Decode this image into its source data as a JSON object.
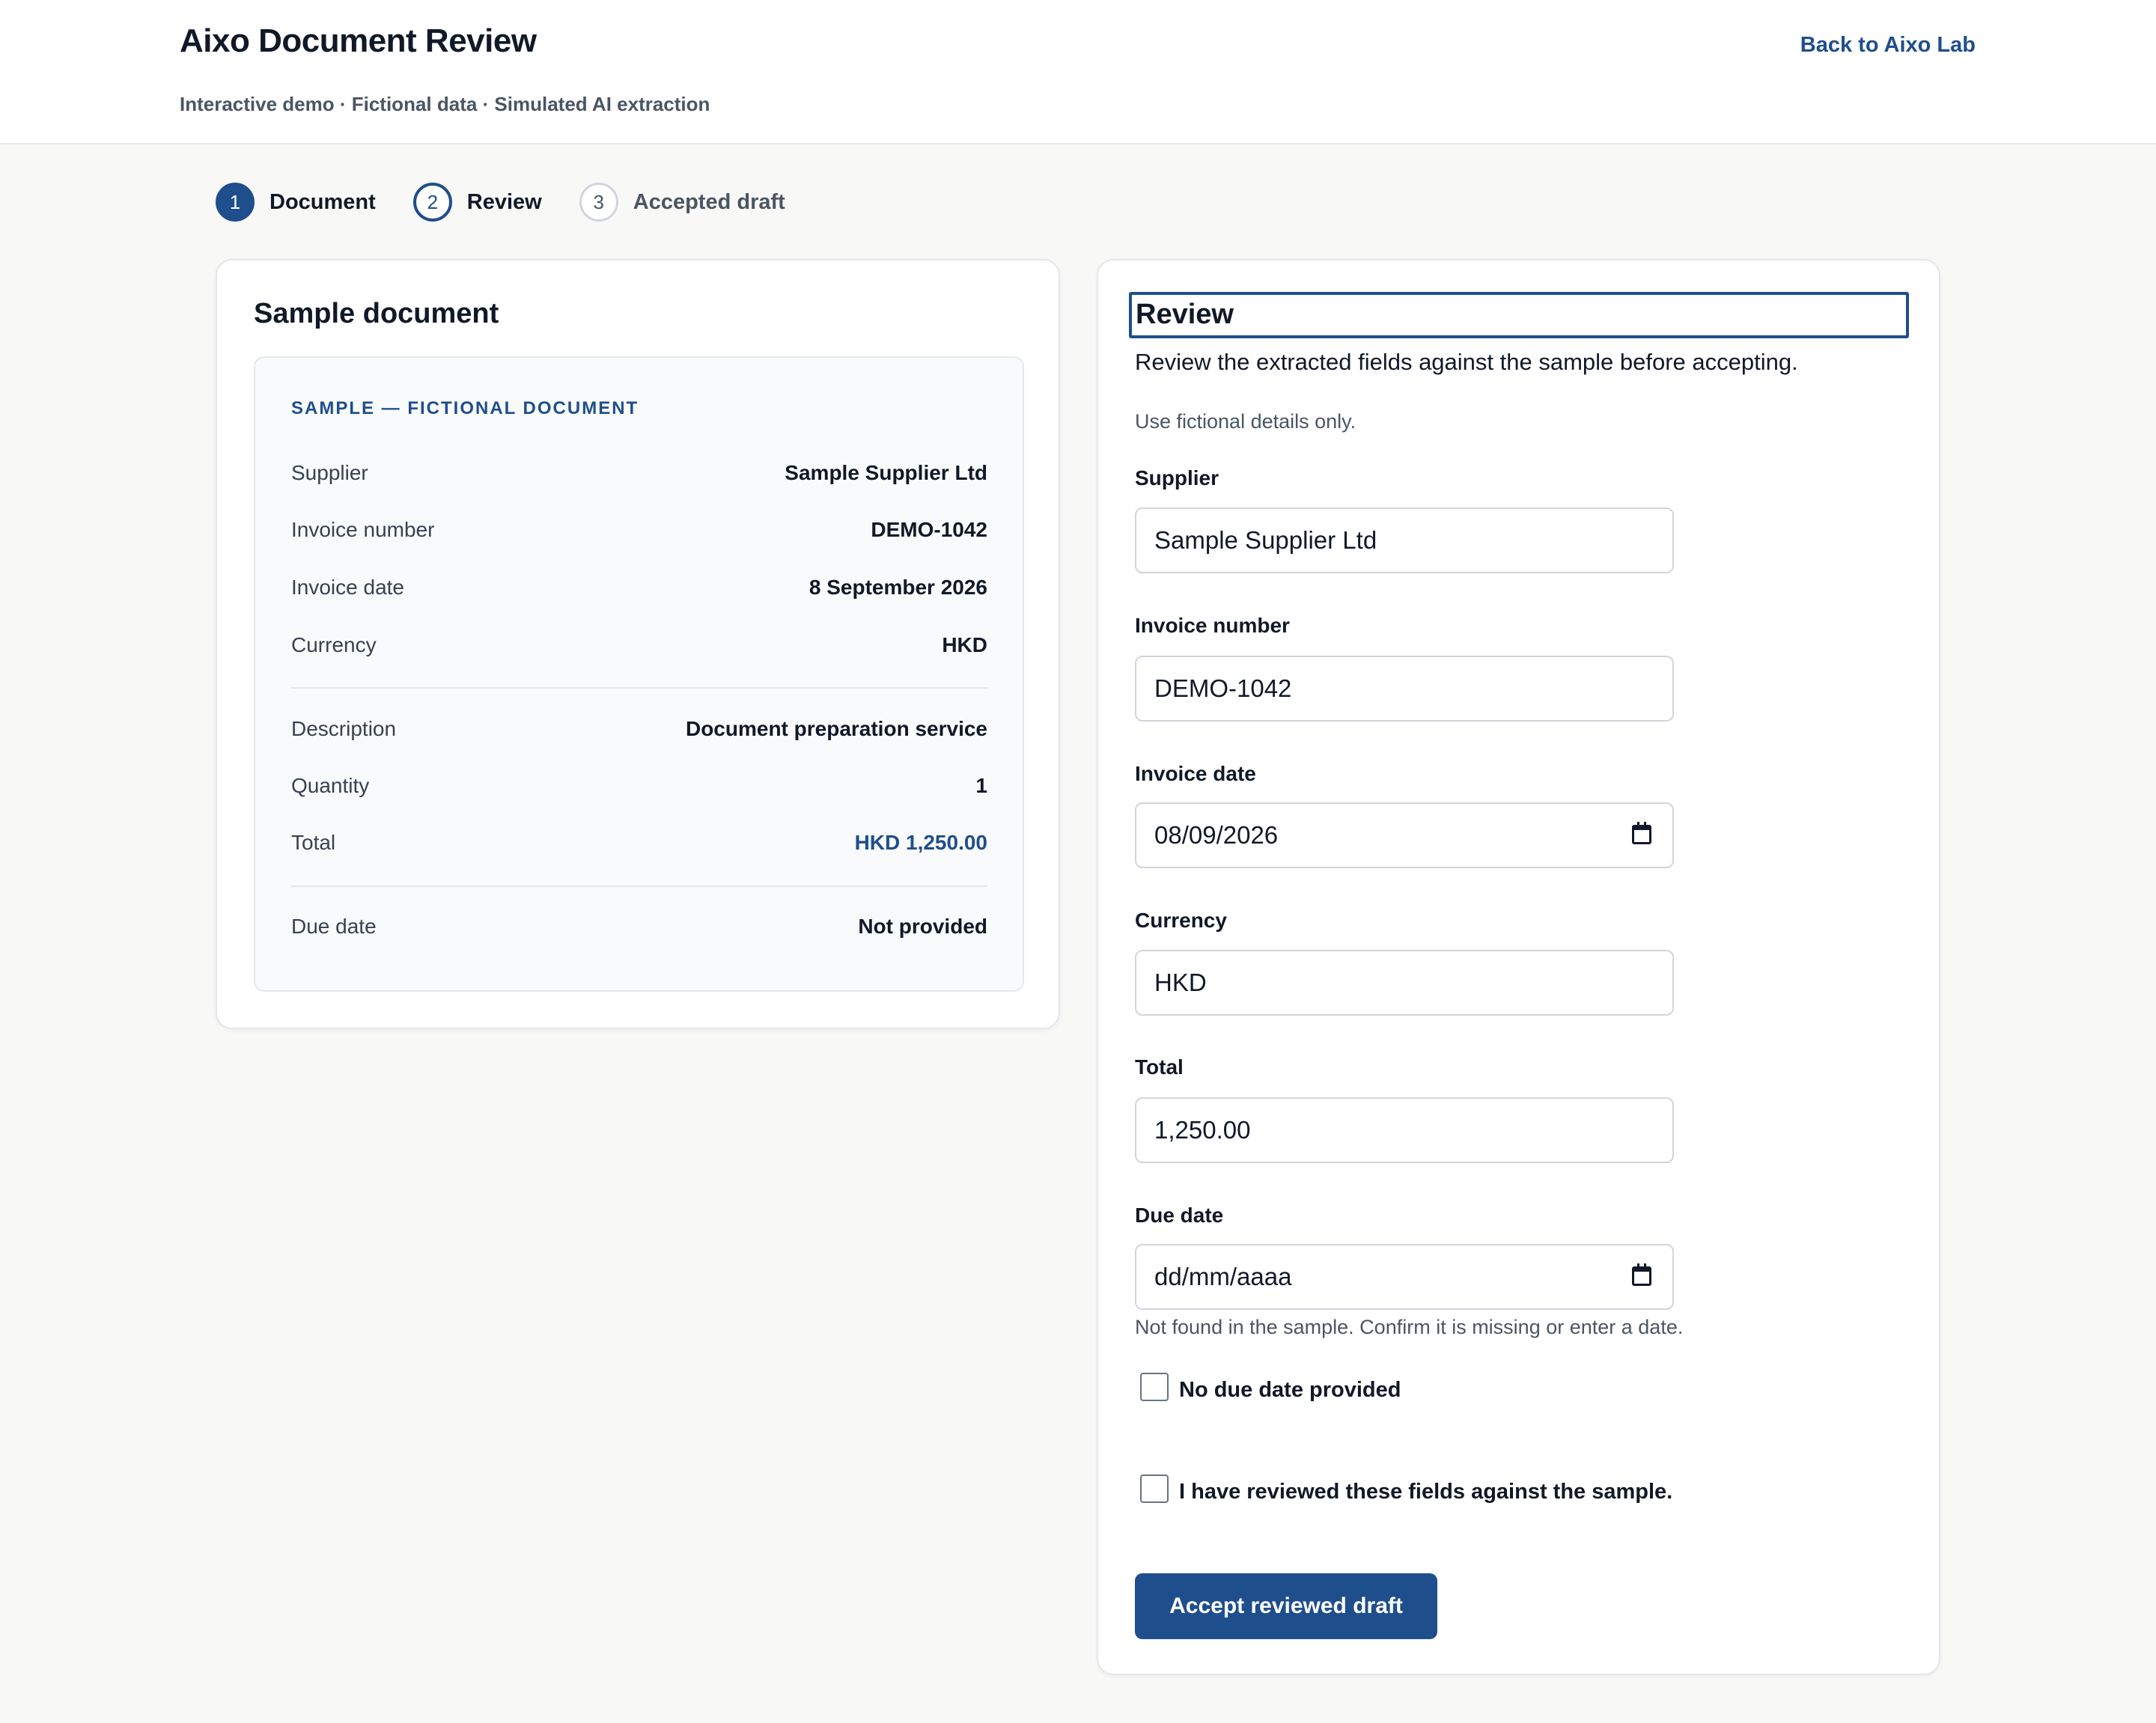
{
  "header": {
    "title": "Aixo Document Review",
    "subtitle": "Interactive demo · Fictional data · Simulated AI extraction",
    "back_link": "Back to Aixo Lab"
  },
  "stepper": {
    "steps": [
      {
        "number": "1",
        "label": "Document",
        "state": "complete"
      },
      {
        "number": "2",
        "label": "Review",
        "state": "current"
      },
      {
        "number": "3",
        "label": "Accepted draft",
        "state": "pending"
      }
    ]
  },
  "sample_card": {
    "title": "Sample document",
    "tag": "SAMPLE — FICTIONAL DOCUMENT",
    "rows": [
      {
        "key": "Supplier",
        "value": "Sample Supplier Ltd"
      },
      {
        "key": "Invoice number",
        "value": "DEMO-1042"
      },
      {
        "key": "Invoice date",
        "value": "8 September 2026"
      },
      {
        "key": "Currency",
        "value": "HKD"
      },
      {
        "key": "Description",
        "value": "Document preparation service"
      },
      {
        "key": "Quantity",
        "value": "1"
      },
      {
        "key": "Total",
        "value": "HKD 1,250.00"
      },
      {
        "key": "Due date",
        "value": "Not provided"
      }
    ]
  },
  "review_card": {
    "title": "Review",
    "intro": "Review the extracted fields against the sample before accepting.",
    "note": "Use fictional details only.",
    "fields": {
      "supplier": {
        "label": "Supplier",
        "value": "Sample Supplier Ltd"
      },
      "invoice_number": {
        "label": "Invoice number",
        "value": "DEMO-1042"
      },
      "invoice_date": {
        "label": "Invoice date",
        "value": "08/09/2026"
      },
      "currency": {
        "label": "Currency",
        "value": "HKD"
      },
      "total": {
        "label": "Total",
        "value": "1,250.00"
      },
      "due_date": {
        "label": "Due date",
        "value": "dd/mm/aaaa",
        "helper": "Not found in the sample. Confirm it is missing or enter a date."
      }
    },
    "no_due_date_label": "No due date provided",
    "confirm_label": "I have reviewed these fields against the sample.",
    "accept_button": "Accept reviewed draft"
  },
  "colors": {
    "accent": "#1f4e8c",
    "background": "#f8f8f7"
  }
}
